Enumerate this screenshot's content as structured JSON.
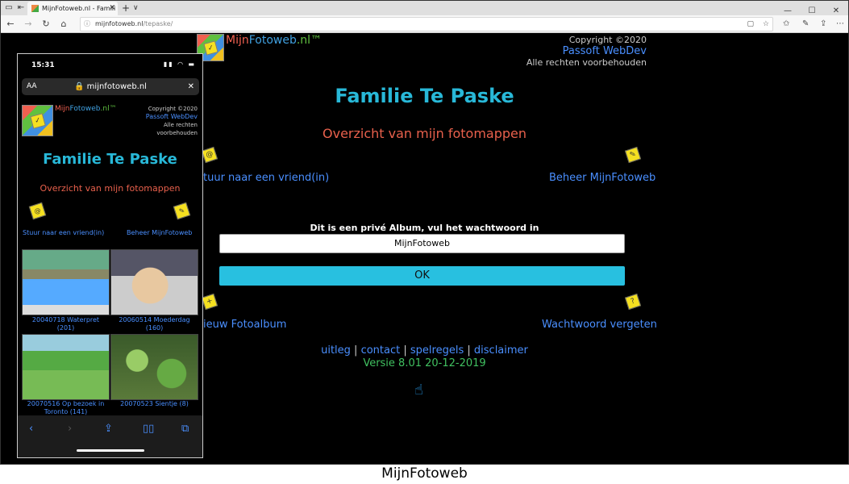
{
  "browser": {
    "tab_title": "MijnFotoweb.nl - Famili",
    "tab_close": "✕",
    "new_tab": "+",
    "tab_menu": "∨",
    "url_host": "mijnfotoweb.nl",
    "url_path": "/tepaske/",
    "controls": [
      "—",
      "☐",
      "✕"
    ]
  },
  "site": {
    "brand_mij": "Mijn",
    "brand_foto": "Fotoweb",
    "brand_nl": ".nl™",
    "copyright": "Copyright ©2020",
    "company": "Passoft WebDev",
    "rights": "Alle rechten voorbehouden",
    "title": "Familie Te Paske",
    "subtitle": "Overzicht van mijn fotomappen",
    "link_send": "Stuur naar een vriend(in)",
    "link_send_visible": "tuur naar een vriend(in)",
    "link_manage": "Beheer MijnFotoweb",
    "password_label": "Dit is een privé Album, vul het wachtwoord in",
    "password_value": "MijnFotoweb",
    "ok_label": "OK",
    "link_new_album": "ieuw Fotoalbum",
    "link_forgot": "Wachtwoord vergeten",
    "footer": {
      "uitleg": "uitleg",
      "contact": "contact",
      "spelregels": "spelregels",
      "disclaimer": "disclaimer",
      "sep": "|"
    },
    "version": "Versie 8.01 20-12-2019"
  },
  "phone": {
    "time": "15:31",
    "aa": "AA",
    "url": "mijnfotoweb.nl",
    "close": "✕",
    "brand_mij": "Mijn",
    "brand_foto": "Fotoweb",
    "brand_nl": ".nl™",
    "copyright": "Copyright ©2020",
    "company": "Passoft WebDev",
    "rights_1": "Alle rechten",
    "rights_2": "voorbehouden",
    "title": "Familie Te Paske",
    "subtitle": "Overzicht van mijn fotomappen",
    "link_send": "Stuur naar een vriend(in)",
    "link_manage": "Beheer MijnFotoweb",
    "albums": [
      {
        "line1": "20040718 Waterpret",
        "line2": "(201)"
      },
      {
        "line1": "20060514 Moederdag",
        "line2": "(160)"
      },
      {
        "line1": "20070516 Op bezoek in",
        "line2": "Toronto (141)"
      },
      {
        "line1": "20070523 Sientje (8)",
        "line2": ""
      }
    ]
  },
  "caption": "MijnFotoweb"
}
